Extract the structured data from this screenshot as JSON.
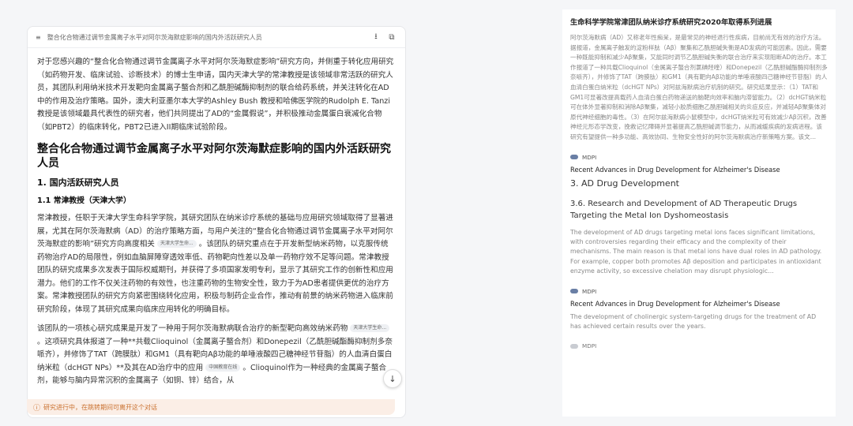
{
  "left": {
    "header_title": "整合化合物通过调节金属离子水平对阿尔茨海默症影响的国内外活跃研究人员",
    "intro": "对于您感兴趣的“整合化合物通过调节金属离子水平对阿尔茨海默症影响”研究方向，并侧重于转化应用研究（如药物开发、临床试验、诊断技术）的博士生申请，国内天津大学的常津教授是该领域非常活跃的研究人员，其团队利用纳米技术开发靶向金属离子螯合剂和乙酰胆碱酶抑制剂的联合给药系统，并关注转化在AD中的作用及治疗策略。国外，澳大利亚墨尔本大学的Ashley Bush 教授和哈佛医学院的Rudolph E. Tanzi 教授是该领域最具代表性的研究者，他们共同提出了AD的“金属假说”，并积极推动金属蛋白衰减化合物（如PBT2）的临床转化，PBT2已进入II期临床试验阶段。",
    "h1": "整合化合物通过调节金属离子水平对阿尔茨海默症影响的国内外活跃研究人员",
    "h2": "1. 国内活跃研究人员",
    "h3": "1.1 常津教授（天津大学）",
    "para1_a": "常津教授，任职于天津大学生命科学学院，其研究团队在纳米诊疗系统的基础与应用研究领域取得了显著进展，尤其在阿尔茨海默病（AD）的治疗策略方面，与用户关注的“整合化合物通过调节金属离子水平对阿尔茨海默症的影响”研究方向高度相关",
    "tag1": "天津大学生命...",
    "para1_b": "。该团队的研究重点在于开发新型纳米药物，以克服传统药物治疗AD的局限性，例如血脑屏障穿透效率低、药物靶向性差以及单一药物疗效不足等问题。常津教授团队的研究成果多次发表于国际权威期刊，并获得了多项国家发明专利，显示了其研究工作的创新性和应用潜力。他们的工作不仅关注药物的有效性，也注重药物的生物安全性，致力于为AD患者提供更优的治疗方案。常津教授团队的研究方向紧密围绕转化应用，积极与制药企业合作，推动有前景的纳米药物进入临床前研究阶段，体现了其研究成果向临床应用转化的明确目标。",
    "para2_a": "该团队的一项核心研究成果是开发了一种用于阿尔茨海默病联合治疗的新型靶向高效纳米药物",
    "tag2": "天津大学生命...",
    "para2_b": "。这项研究具体报道了一种**共载Clioquinol（金属离子螯合剂）和Donepezil（乙酰胆碱酯酶抑制剂多奈哌齐），并修饰了TAT（跨膜肽）和GM1（具有靶向Aβ功能的单唾液酸四己糖神经节苷脂）的人血清白蛋白纳米粒（dcHGT NPs）**及其在AD治疗中的应用",
    "tag3": "中国教育在线",
    "para2_c": "。Clioquinol作为一种经典的金属离子螯合剂，能够与脑内异常沉积的金属离子（如铜、锌）结合，从"
  },
  "status_text": "研究进行中，在跳转期间可离开这个对话",
  "right": {
    "r1_title": "生命科学学院常津团队纳米诊疗系统研究2020年取得系列进展",
    "r1_text": "阿尔茨海默病（AD）又称老年性痴呆，是最常见的神经退行性疾病，目前尚无有效的治疗方法。据报道，金属离子触发的淀粉样肽（Aβ）聚集和乙酰胆碱失衡是AD发病的可能因素。因此，需要一种既能抑制和减少Aβ聚集，又能同时调节乙酰胆碱失衡的联合治疗来实现阻断AD的治疗。本工作报道了一种共载Clioquinol（金属离子螯合剂氯碘羟喹）和Donepezil（乙酰胆碱酯酶抑制剂多奈哌齐），并修饰了TAT（跨膜肽）和GM1（具有靶向Aβ功能的单唾液酸四己糖神经节苷脂）的人血清白蛋白纳米粒（dcHGT NPs）对阿兹海默病治疗机制的研究。研究结果显示：（1）TAT和GM1可显著改提高载药人血清白蛋白药物递送的脑靶向效率和脑内滞留能力。（2）dcHGT纳米粒可在体外显著抑制和消除Aβ聚集，减轻小胶质细胞乙酰胆碱相关的炎症反应，并减轻Aβ聚集体对原代神经细胞的毒性。（3）在阿尔兹海默病小鼠模型中，dcHGT纳米粒可有效减少Aβ沉积，改善神经元形态学改变，挽救记忆障碍并显著提高乙酰胆碱调节能力，从而减缓疾病的发病进程。该研究有望提供一种多功能、高效协同、生物安全性好的阿尔茨海默病治疗新策略方案。该文...",
    "src1": "MDPI",
    "a1_title": "Recent Advances in Drug Development for Alzheimer's Disease",
    "a1_section": "3. AD Drug Development",
    "a1_subsection": "3.6. Research and Development of AD Therapeutic Drugs Targeting the Metal Ion Dyshomeostasis",
    "a1_text": "The development of AD drugs targeting metal ions faces significant limitations, with controversies regarding their efficacy and the complexity of their mechanisms. The main reason is that metal ions have dual roles in AD pathology. For example, copper both promotes Aβ deposition and participates in antioxidant enzyme activity, so excessive chelation may disrupt physiologic...",
    "src2": "MDPI",
    "a2_title": "Recent Advances in Drug Development for Alzheimer's Disease",
    "a2_text": "The development of cholinergic system-targeting drugs for the treatment of AD has achieved certain results over the years.",
    "src3": "MDPI"
  }
}
